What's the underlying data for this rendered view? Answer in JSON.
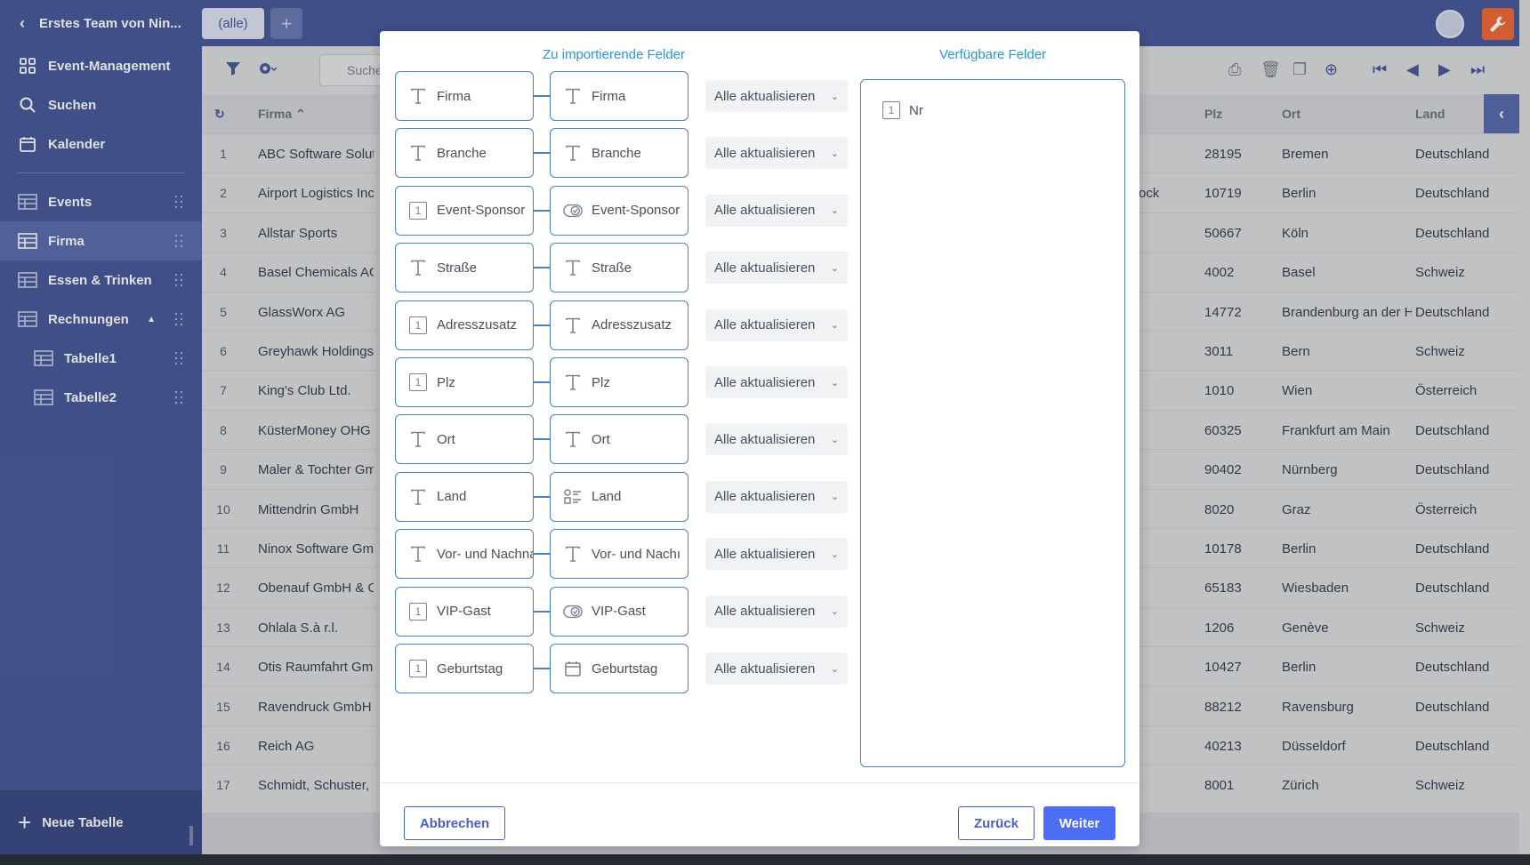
{
  "sidebar": {
    "team_name": "Erstes Team von Nin...",
    "nav": [
      {
        "label": "Event-Management",
        "icon": "grid-icon"
      },
      {
        "label": "Suchen",
        "icon": "search-icon"
      },
      {
        "label": "Kalender",
        "icon": "calendar-icon"
      }
    ],
    "tables": [
      {
        "label": "Events"
      },
      {
        "label": "Firma"
      },
      {
        "label": "Essen & Trinken"
      },
      {
        "label": "Rechnungen"
      }
    ],
    "subtables": [
      {
        "label": "Tabelle1"
      },
      {
        "label": "Tabelle2"
      }
    ],
    "new_table": "Neue Tabelle"
  },
  "topbar": {
    "tab_all": "(alle)",
    "tab_add": "+"
  },
  "toolbar": {
    "search_placeholder": "Suche"
  },
  "grid": {
    "columns": [
      "Firma",
      "Plz",
      "Ort",
      "Land"
    ],
    "rows": [
      {
        "n": "1",
        "firma": "ABC Software Soluti",
        "plz": "28195",
        "ort": "Bremen",
        "land": "Deutschland",
        "extra": ""
      },
      {
        "n": "2",
        "firma": "Airport Logistics Inc.",
        "plz": "10719",
        "ort": "Berlin",
        "land": "Deutschland",
        "extra": "ock"
      },
      {
        "n": "3",
        "firma": "Allstar Sports",
        "plz": "50667",
        "ort": "Köln",
        "land": "Deutschland",
        "extra": ""
      },
      {
        "n": "4",
        "firma": "Basel Chemicals AG",
        "plz": "4002",
        "ort": "Basel",
        "land": "Schweiz",
        "extra": ""
      },
      {
        "n": "5",
        "firma": "GlassWorx AG",
        "plz": "14772",
        "ort": "Brandenburg an der H",
        "land": "Deutschland",
        "extra": ""
      },
      {
        "n": "6",
        "firma": "Greyhawk Holdings",
        "plz": "3011",
        "ort": "Bern",
        "land": "Schweiz",
        "extra": ""
      },
      {
        "n": "7",
        "firma": "King's Club Ltd.",
        "plz": "1010",
        "ort": "Wien",
        "land": "Österreich",
        "extra": ""
      },
      {
        "n": "8",
        "firma": "KüsterMoney OHG",
        "plz": "60325",
        "ort": "Frankfurt am Main",
        "land": "Deutschland",
        "extra": ""
      },
      {
        "n": "9",
        "firma": "Maler & Tochter Gm",
        "plz": "90402",
        "ort": "Nürnberg",
        "land": "Deutschland",
        "extra": ""
      },
      {
        "n": "10",
        "firma": "Mittendrin GmbH",
        "plz": "8020",
        "ort": "Graz",
        "land": "Österreich",
        "extra": ""
      },
      {
        "n": "11",
        "firma": "Ninox Software Gmb",
        "plz": "10178",
        "ort": "Berlin",
        "land": "Deutschland",
        "extra": ""
      },
      {
        "n": "12",
        "firma": "Obenauf GmbH & Co",
        "plz": "65183",
        "ort": "Wiesbaden",
        "land": "Deutschland",
        "extra": ""
      },
      {
        "n": "13",
        "firma": "Ohlala S.à r.l.",
        "plz": "1206",
        "ort": "Genève",
        "land": "Schweiz",
        "extra": ""
      },
      {
        "n": "14",
        "firma": "Otis Raumfahrt Gmb",
        "plz": "10427",
        "ort": "Berlin",
        "land": "Deutschland",
        "extra": ""
      },
      {
        "n": "15",
        "firma": "Ravendruck GmbH",
        "plz": "88212",
        "ort": "Ravensburg",
        "land": "Deutschland",
        "extra": ""
      },
      {
        "n": "16",
        "firma": "Reich AG",
        "plz": "40213",
        "ort": "Düsseldorf",
        "land": "Deutschland",
        "extra": ""
      },
      {
        "n": "17",
        "firma": "Schmidt, Schuster, M",
        "plz": "8001",
        "ort": "Zürich",
        "land": "Schweiz",
        "extra": ""
      }
    ]
  },
  "modal": {
    "title_import": "Zu importierende Felder",
    "title_available": "Verfügbare Felder",
    "mappings": [
      {
        "source": "Firma",
        "source_icon": "text-icon",
        "target": "Firma",
        "target_icon": "text-icon",
        "mode": "Alle aktualisieren"
      },
      {
        "source": "Branche",
        "source_icon": "text-icon",
        "target": "Branche",
        "target_icon": "text-icon",
        "mode": "Alle aktualisieren"
      },
      {
        "source": "Event-Sponsor",
        "source_icon": "number-icon",
        "target": "Event-Sponsor",
        "target_icon": "toggle-icon",
        "mode": "Alle aktualisieren"
      },
      {
        "source": "Straße",
        "source_icon": "text-icon",
        "target": "Straße",
        "target_icon": "text-icon",
        "mode": "Alle aktualisieren"
      },
      {
        "source": "Adresszusatz",
        "source_icon": "number-icon",
        "target": "Adresszusatz",
        "target_icon": "text-icon",
        "mode": "Alle aktualisieren"
      },
      {
        "source": "Plz",
        "source_icon": "number-icon",
        "target": "Plz",
        "target_icon": "text-icon",
        "mode": "Alle aktualisieren"
      },
      {
        "source": "Ort",
        "source_icon": "text-icon",
        "target": "Ort",
        "target_icon": "text-icon",
        "mode": "Alle aktualisieren"
      },
      {
        "source": "Land",
        "source_icon": "text-icon",
        "target": "Land",
        "target_icon": "choice-icon",
        "mode": "Alle aktualisieren"
      },
      {
        "source": "Vor- und Nachna",
        "source_icon": "text-icon",
        "target": "Vor- und Nachı",
        "target_icon": "text-icon",
        "mode": "Alle aktualisieren"
      },
      {
        "source": "VIP-Gast",
        "source_icon": "number-icon",
        "target": "VIP-Gast",
        "target_icon": "toggle-icon",
        "mode": "Alle aktualisieren"
      },
      {
        "source": "Geburtstag",
        "source_icon": "number-icon",
        "target": "Geburtstag",
        "target_icon": "calendar-icon",
        "mode": "Alle aktualisieren"
      }
    ],
    "available_fields": [
      {
        "label": "Nr",
        "icon": "number-icon"
      }
    ],
    "cancel": "Abbrechen",
    "back": "Zurück",
    "next": "Weiter"
  }
}
